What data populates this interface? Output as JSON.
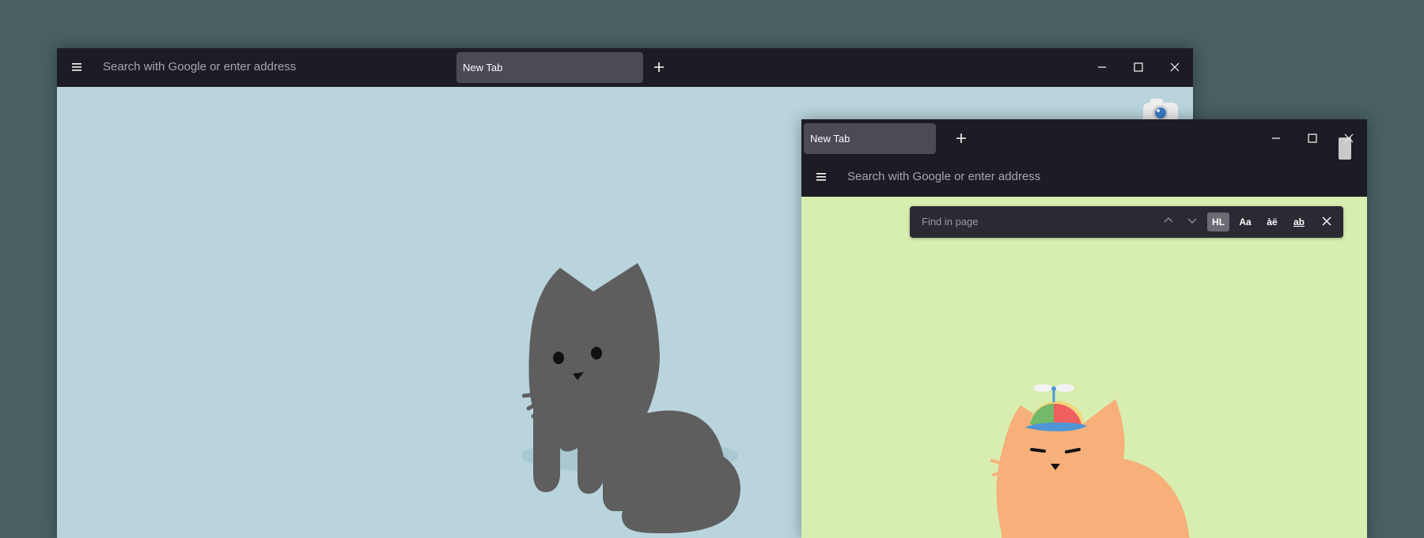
{
  "windows": {
    "back": {
      "tabs": [
        {
          "label": "New Tab"
        }
      ],
      "address_placeholder": "Search with Google or enter address"
    },
    "front": {
      "tabs": [
        {
          "label": "New Tab"
        }
      ],
      "address_placeholder": "Search with Google or enter address",
      "findbar": {
        "placeholder": "Find in page",
        "options": [
          {
            "label": "HL",
            "active": true
          },
          {
            "label": "Aa",
            "active": false
          },
          {
            "label": "àë",
            "active": false
          },
          {
            "label": "ab",
            "active": false,
            "underlined": true
          }
        ]
      }
    }
  },
  "colors": {
    "desktop": "#486061",
    "chrome": "#1d1c24",
    "tab_selected": "#4b4b55",
    "back_page": "#b9d4dd",
    "front_page": "#d7eeb0",
    "findbar": "#2b2a33",
    "findbar_active_option": "#6b6b73",
    "placeholder": "#a6a6ad",
    "back_cat": "#5e5e5f",
    "front_cat": "#f7b07a"
  },
  "icons": {
    "menu": "menu-icon",
    "new_tab": "plus-icon",
    "minimize": "minimize-icon",
    "maximize": "maximize-icon",
    "close": "close-icon",
    "camera": "camera-icon",
    "chevron_up": "chevron-up-icon",
    "chevron_down": "chevron-down-icon"
  }
}
